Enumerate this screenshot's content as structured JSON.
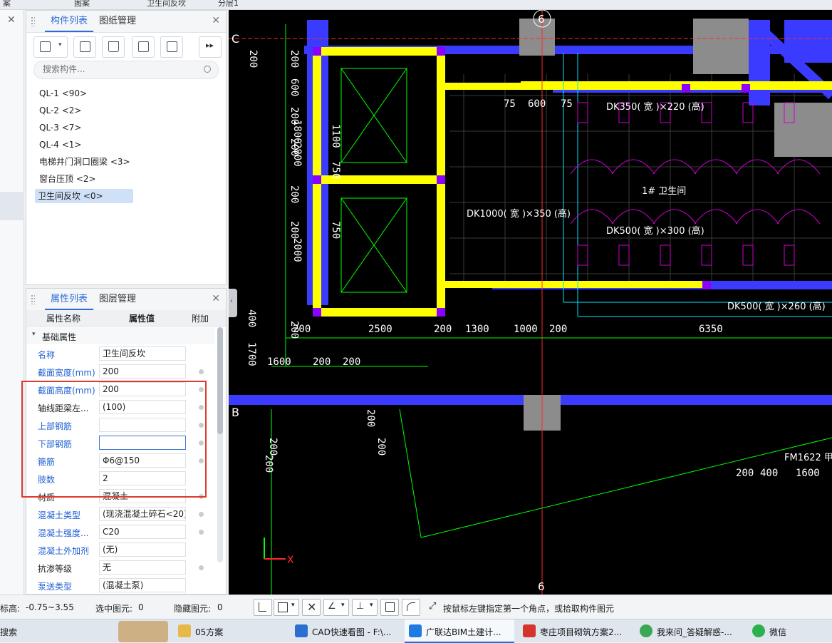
{
  "top_strip": {
    "items": [
      "案",
      "图案",
      "卫生间反坎",
      "分层1"
    ]
  },
  "component_panel": {
    "tabs": [
      "构件列表",
      "图纸管理"
    ],
    "search_placeholder": "搜索构件...",
    "items": [
      {
        "label": "QL-1 <90>"
      },
      {
        "label": "QL-2 <2>"
      },
      {
        "label": "QL-3 <7>"
      },
      {
        "label": "QL-4 <1>"
      },
      {
        "label": "电梯井门洞口圈梁 <3>"
      },
      {
        "label": "窗台压顶 <2>"
      },
      {
        "label": "卫生间反坎 <0>",
        "selected": true
      }
    ]
  },
  "property_panel": {
    "tabs": [
      "属性列表",
      "图层管理"
    ],
    "columns": [
      "属性名称",
      "属性值",
      "附加"
    ],
    "group": "基础属性",
    "rows": [
      {
        "name": "名称",
        "value": "卫生间反坎",
        "blue": true,
        "dot": false
      },
      {
        "name": "截面宽度(mm)",
        "value": "200",
        "blue": true,
        "dot": true
      },
      {
        "name": "截面高度(mm)",
        "value": "200",
        "blue": true,
        "dot": true
      },
      {
        "name": "轴线距梁左...",
        "value": "(100)",
        "blue": false,
        "dot": true
      },
      {
        "name": "上部钢筋",
        "value": "",
        "blue": true,
        "dot": true
      },
      {
        "name": "下部钢筋",
        "value": "",
        "blue": true,
        "dot": true,
        "focus": true
      },
      {
        "name": "箍筋",
        "value": "Φ6@150",
        "blue": true,
        "dot": true
      },
      {
        "name": "肢数",
        "value": "2",
        "blue": true,
        "dot": false
      },
      {
        "name": "材质",
        "value": "混凝土",
        "blue": false,
        "dot": true
      },
      {
        "name": "混凝土类型",
        "value": "(现浇混凝土碎石<20)",
        "blue": true,
        "dot": true
      },
      {
        "name": "混凝土强度...",
        "value": "C20",
        "blue": true,
        "dot": true
      },
      {
        "name": "混凝土外加剂",
        "value": "(无)",
        "blue": true,
        "dot": false
      },
      {
        "name": "抗渗等级",
        "value": "无",
        "blue": false,
        "dot": true
      },
      {
        "name": "泵送类型",
        "value": "(混凝土泵)",
        "blue": true,
        "dot": false
      }
    ]
  },
  "status_bar": {
    "elevation_label": "标高:",
    "elevation_value": "-0.75~3.55",
    "selected_label": "选中图元:",
    "selected_value": "0",
    "hidden_label": "隐藏图元:",
    "hidden_value": "0",
    "hint": "按鼠标左键指定第一个角点，或拾取构件图元"
  },
  "taskbar": {
    "search": "搜索",
    "items": [
      {
        "label": "05方案",
        "color": "#e8b84a"
      },
      {
        "label": "CAD快速看图 - F:\\...",
        "color": "#2a6fd1"
      },
      {
        "label": "广联达BIM土建计...",
        "color": "#1f7be0",
        "active": true
      },
      {
        "label": "枣庄项目砌筑方案2...",
        "color": "#d6342a"
      },
      {
        "label": "我来问_答疑解惑-...",
        "color": "#3aa757"
      },
      {
        "label": "微信",
        "color": "#2bb24c"
      }
    ]
  },
  "drawing": {
    "axis_labels": [
      "C",
      "B",
      "6"
    ],
    "dimensions": [
      "200",
      "200",
      "600",
      "200",
      "200",
      "2800",
      "200",
      "1800",
      "200",
      "2000",
      "200",
      "400",
      "1700",
      "200",
      "2500",
      "200",
      "1300",
      "1000",
      "200",
      "6350",
      "1600",
      "200",
      "200",
      "75",
      "600",
      "75",
      "1100",
      "750",
      "750",
      "200",
      "200",
      "200",
      "1600",
      "200",
      "400",
      "200"
    ],
    "annotations": [
      "DK350( 宽 )×220 (高)",
      "DK1000( 宽 )×350 (高)",
      "DK500( 宽 )×300 (高)",
      "DK500( 宽 )×260 (高)",
      "1# 卫生间",
      "FM1622 甲"
    ],
    "colors": {
      "wall": "#3b3bff",
      "beam": "#ffff00",
      "column": "#8a8a8a",
      "line": "#00ff00",
      "magenta": "#d000d0",
      "cyan": "#00e5ff",
      "red": "#ff2a2a"
    }
  }
}
